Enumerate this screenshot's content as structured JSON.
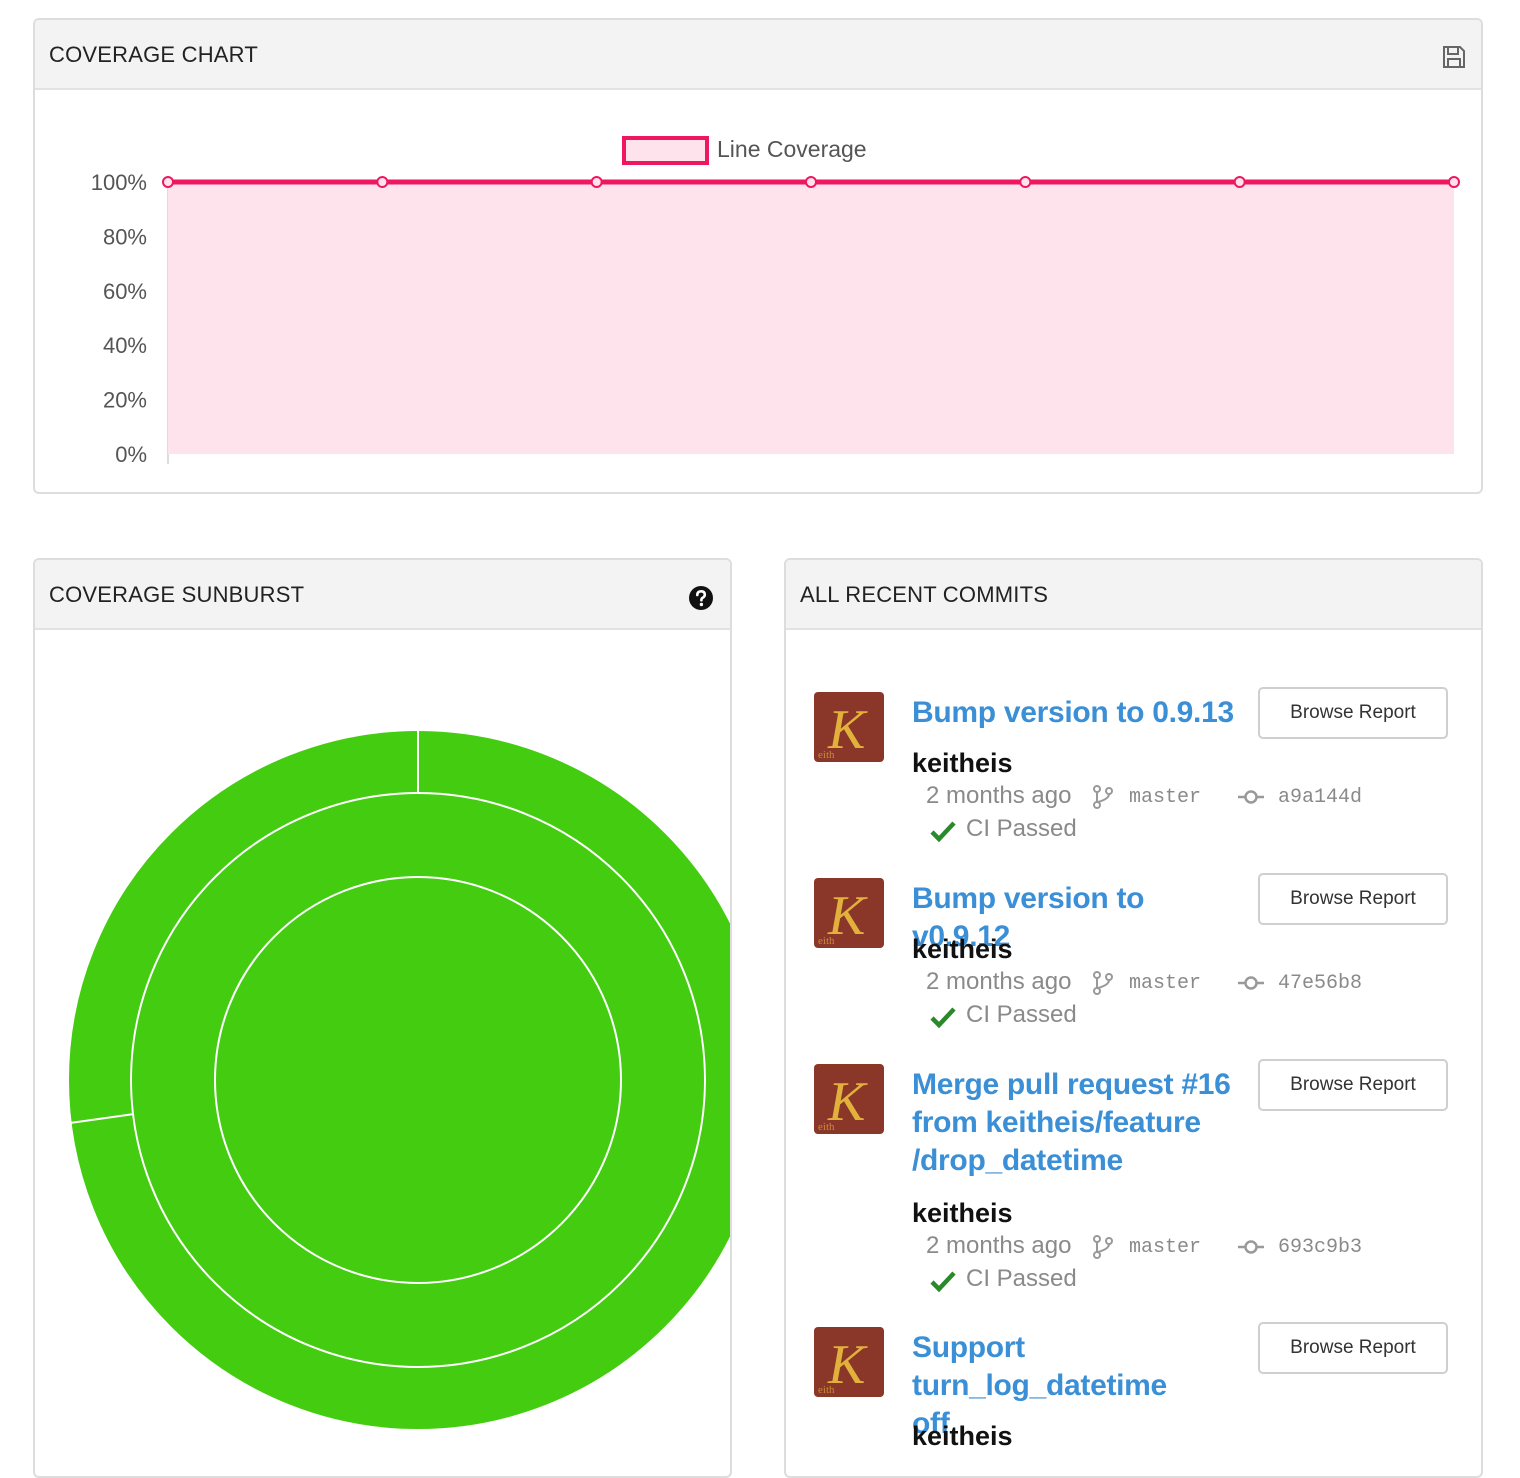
{
  "colors": {
    "line": "#ee1760",
    "fill": "#ffe3ec",
    "sunburst_green": "#44cc11",
    "link": "#3a8fd6",
    "ci_check": "#2a8a2a",
    "avatar_bg": "#8a3628",
    "avatar_letter": "#e2b13c"
  },
  "coverage_chart": {
    "title": "COVERAGE CHART",
    "save_icon": "floppy-disk-icon"
  },
  "chart_data": {
    "type": "area",
    "series": [
      {
        "name": "Line Coverage",
        "values": [
          100,
          100,
          100,
          100,
          100,
          100,
          100
        ]
      }
    ],
    "ylim": [
      0,
      100
    ],
    "yticks": [
      "100%",
      "80%",
      "60%",
      "40%",
      "20%",
      "0%"
    ],
    "ytick_values": [
      100,
      80,
      60,
      40,
      20,
      0
    ],
    "legend": "top-center",
    "grid": false
  },
  "sunburst": {
    "title": "COVERAGE SUNBURST",
    "help_icon": "question-circle-icon"
  },
  "commits_panel": {
    "title": "ALL RECENT COMMITS",
    "browse_label": "Browse Report",
    "avatar_letter": "K",
    "avatar_sub": "eith",
    "items": [
      {
        "title": "Bump version to 0.9.13",
        "author": "keitheis",
        "time": "2 months ago",
        "branch": "master",
        "sha": "a9a144d",
        "ci": "CI Passed"
      },
      {
        "title": "Bump version to v0.9.12",
        "author": "keitheis",
        "time": "2 months ago",
        "branch": "master",
        "sha": "47e56b8",
        "ci": "CI Passed"
      },
      {
        "title": "Merge pull request #16 from keitheis/feature /drop_datetime",
        "author": "keitheis",
        "time": "2 months ago",
        "branch": "master",
        "sha": "693c9b3",
        "ci": "CI Passed"
      },
      {
        "title": "Support turn_log_datetime off",
        "author": "keitheis"
      }
    ]
  }
}
